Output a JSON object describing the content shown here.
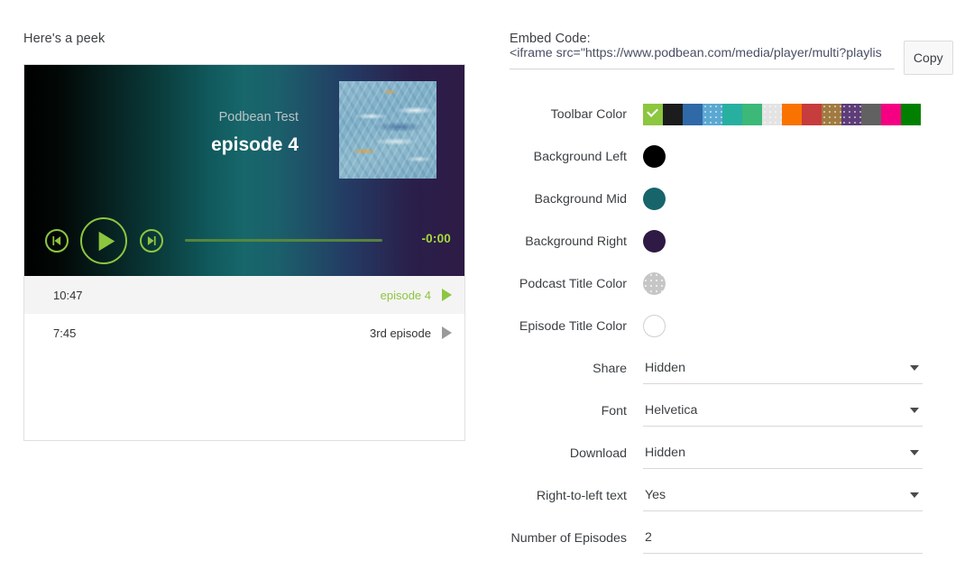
{
  "left": {
    "peek_label": "Here's a peek",
    "player": {
      "podcast_name": "Podbean Test",
      "episode_title": "episode 4",
      "time_remaining": "-0:00",
      "prev_icon": "skip-previous-icon",
      "play_icon": "play-icon",
      "next_icon": "skip-next-icon",
      "progress_percent": 100
    },
    "playlist": [
      {
        "duration": "10:47",
        "title": "episode 4",
        "active": true
      },
      {
        "duration": "7:45",
        "title": "3rd episode",
        "active": false
      }
    ]
  },
  "right": {
    "embed_label": "Embed Code:",
    "embed_code": "<iframe src=\"https://www.podbean.com/media/player/multi?playlis",
    "copy_label": "Copy",
    "fields": [
      {
        "label": "Toolbar Color",
        "type": "swatches"
      },
      {
        "label": "Background Left",
        "type": "dot",
        "value": "#000000"
      },
      {
        "label": "Background Mid",
        "type": "dot",
        "value": "#17646b"
      },
      {
        "label": "Background Right",
        "type": "dot",
        "value": "#2e1a44"
      },
      {
        "label": "Podcast Title Color",
        "type": "dot",
        "value": "#c6c6c6",
        "textured": true
      },
      {
        "label": "Episode Title Color",
        "type": "dot",
        "value": "#ffffff",
        "ring": true
      },
      {
        "label": "Share",
        "type": "select",
        "value": "Hidden"
      },
      {
        "label": "Font",
        "type": "select",
        "value": "Helvetica"
      },
      {
        "label": "Download",
        "type": "select",
        "value": "Hidden"
      },
      {
        "label": "Right-to-left text",
        "type": "select",
        "value": "Yes"
      },
      {
        "label": "Number of Episodes",
        "type": "text",
        "value": "2"
      }
    ],
    "toolbar_swatches": [
      {
        "color": "#8dc63f",
        "selected": true,
        "textured": false
      },
      {
        "color": "#1c1c1c",
        "selected": false,
        "textured": false
      },
      {
        "color": "#3069a8",
        "selected": false,
        "textured": false
      },
      {
        "color": "#5aa8d2",
        "selected": false,
        "textured": true
      },
      {
        "color": "#27b0a0",
        "selected": false,
        "textured": false
      },
      {
        "color": "#3cb878",
        "selected": false,
        "textured": false
      },
      {
        "color": "#e3e3e3",
        "selected": false,
        "textured": true
      },
      {
        "color": "#fa7300",
        "selected": false,
        "textured": false
      },
      {
        "color": "#c73c3c",
        "selected": false,
        "textured": false
      },
      {
        "color": "#a07a41",
        "selected": false,
        "textured": true
      },
      {
        "color": "#5d3d78",
        "selected": false,
        "textured": true
      },
      {
        "color": "#616161",
        "selected": false,
        "textured": false
      },
      {
        "color": "#f50082",
        "selected": false,
        "textured": false
      },
      {
        "color": "#018000",
        "selected": false,
        "textured": false
      }
    ]
  }
}
